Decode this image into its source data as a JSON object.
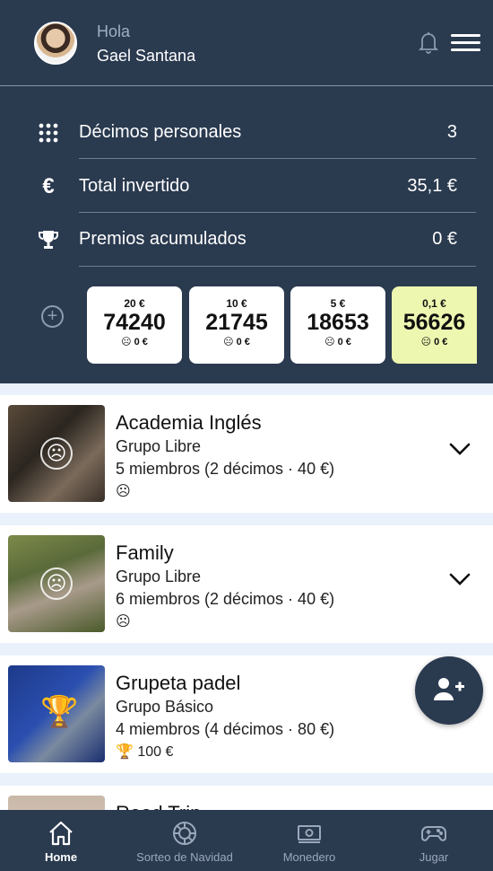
{
  "header": {
    "greeting": "Hola",
    "user_name": "Gael Santana",
    "icons": {
      "bell": "bell-icon",
      "menu": "menu-icon"
    }
  },
  "stats": [
    {
      "icon": "dots-grid-icon",
      "label": "Décimos personales",
      "value": "3"
    },
    {
      "icon": "euro-icon",
      "label": "Total invertido",
      "value": "35,1 €"
    },
    {
      "icon": "trophy-icon",
      "label": "Premios acumulados",
      "value": "0 €"
    }
  ],
  "tickets": [
    {
      "price": "20 €",
      "number": "74240",
      "winnings": "☹ 0 €",
      "highlight": false
    },
    {
      "price": "10 €",
      "number": "21745",
      "winnings": "☹ 0 €",
      "highlight": false
    },
    {
      "price": "5 €",
      "number": "18653",
      "winnings": "☹ 0 €",
      "highlight": false
    },
    {
      "price": "0,1 €",
      "number": "56626",
      "winnings": "☹ 0 €",
      "highlight": true
    }
  ],
  "groups": [
    {
      "name": "Academia Inglés",
      "type": "Grupo Libre",
      "members": "5 miembros (2 décimos · 40 €)",
      "status": "☹",
      "overlay": "sad-face-icon"
    },
    {
      "name": "Family",
      "type": "Grupo Libre",
      "members": "6 miembros (2 décimos · 40 €)",
      "status": "☹",
      "overlay": "sad-face-icon"
    },
    {
      "name": "Grupeta padel",
      "type": "Grupo Básico",
      "members": "4 miembros (4 décimos · 80 €)",
      "status": "🏆 100 €",
      "overlay": "trophy-icon"
    },
    {
      "name": "Road Trip",
      "type": "",
      "members": "",
      "status": "",
      "overlay": ""
    }
  ],
  "fab": {
    "icon": "add-user-icon"
  },
  "tabs": [
    {
      "label": "Home",
      "icon": "home-icon",
      "active": true
    },
    {
      "label": "Sorteo de Navidad",
      "icon": "lottery-drum-icon",
      "active": false
    },
    {
      "label": "Monedero",
      "icon": "wallet-cash-icon",
      "active": false
    },
    {
      "label": "Jugar",
      "icon": "gamepad-icon",
      "active": false
    }
  ],
  "colors": {
    "primary": "#2a3a4f",
    "background": "#eaf1fb",
    "ticket_highlight": "#eef7b0"
  }
}
